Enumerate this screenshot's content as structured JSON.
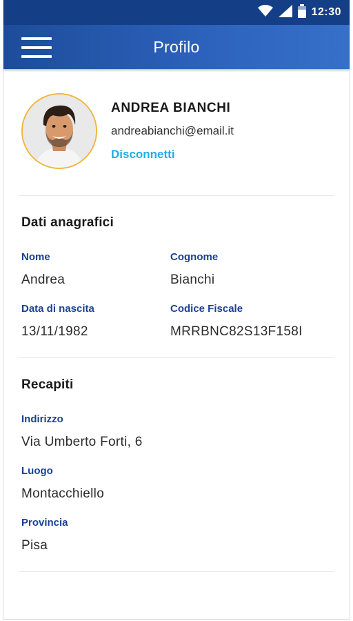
{
  "status_bar": {
    "time": "12:30",
    "icons": [
      "wifi-icon",
      "cellular-signal-icon",
      "battery-icon"
    ],
    "background": "#143f86"
  },
  "app_bar": {
    "title": "Profilo",
    "menu_icon": "hamburger-menu-icon",
    "gradient_start": "#1d4c9a",
    "gradient_end": "#3670c9"
  },
  "profile": {
    "name": "ANDREA BIANCHI",
    "email": "andreabianchi@email.it",
    "logout_label": "Disconnetti",
    "avatar_border": "#f0b63c"
  },
  "anagrafica": {
    "title": "Dati anagrafici",
    "fields": [
      {
        "label": "Nome",
        "value": "Andrea"
      },
      {
        "label": "Cognome",
        "value": "Bianchi"
      },
      {
        "label": "Data di nascita",
        "value": "13/11/1982"
      },
      {
        "label": "Codice Fiscale",
        "value": "MRRBNC82S13F158I"
      }
    ]
  },
  "recapiti": {
    "title": "Recapiti",
    "fields": [
      {
        "label": "Indirizzo",
        "value": "Via Umberto Forti, 6"
      },
      {
        "label": "Luogo",
        "value": "Montacchiello"
      },
      {
        "label": "Provincia",
        "value": "Pisa"
      }
    ]
  },
  "colors": {
    "accent_link": "#1eaee3",
    "field_label": "#1a4191"
  }
}
